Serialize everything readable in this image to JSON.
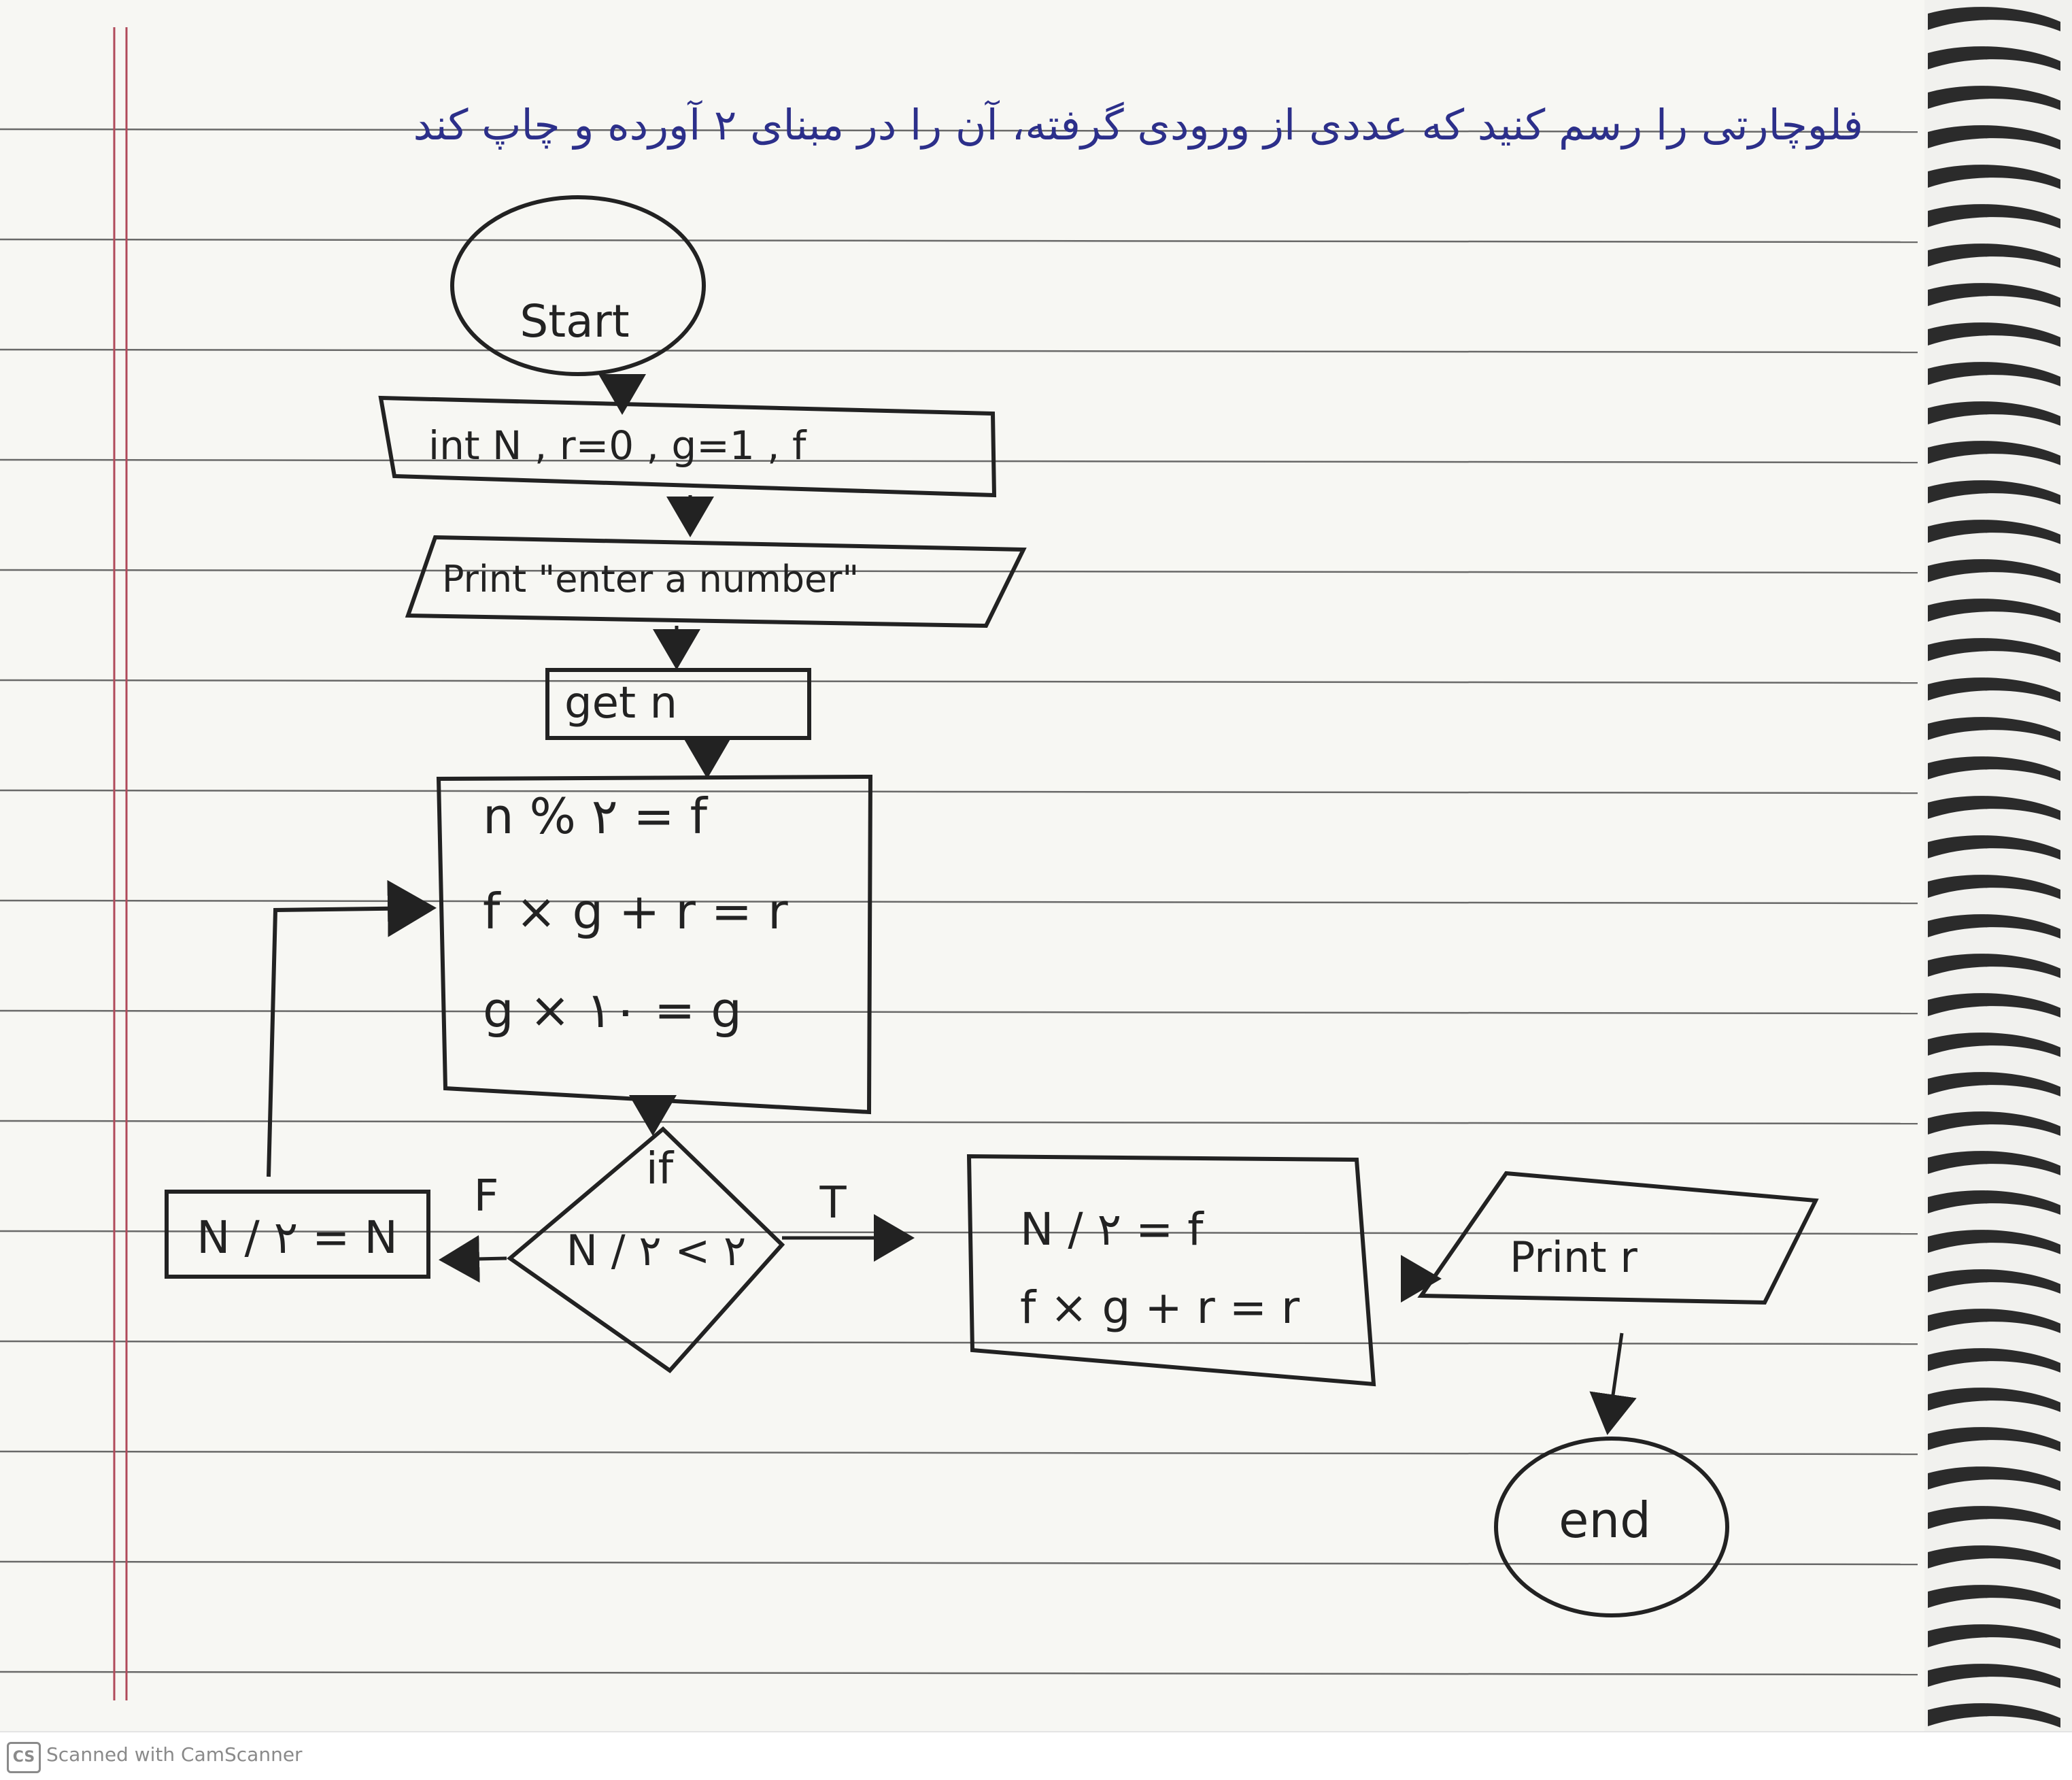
{
  "header": {
    "title": "فلوچارتی را رسم کنید که عددی از ورودی گرفته، آن را در مبنای ۲ آورده و چاپ کند"
  },
  "flowchart": {
    "start": "Start",
    "init": "int  N , r=0 , g=1 , f",
    "prompt": "Print \"enter a number\"",
    "input": "get  n",
    "loop_body": [
      "n % ۲ = f",
      "f × g + r = r",
      "g × ۱۰ = g"
    ],
    "decision": [
      "if",
      "N / ۲ < ۲"
    ],
    "false_label": "F",
    "true_label": "T",
    "false_box": "N / ۲ = N",
    "true_box": [
      "N / ۲ = f",
      "f × g + r = r"
    ],
    "output": "Print  r",
    "end": "end"
  },
  "footer": {
    "logo": "CS",
    "text": "Scanned with CamScanner"
  },
  "colors": {
    "ink": "#222222",
    "title_ink": "#2c2f8a",
    "rule_line": "#3a3a3a",
    "margin_line": "#b04a5a"
  }
}
